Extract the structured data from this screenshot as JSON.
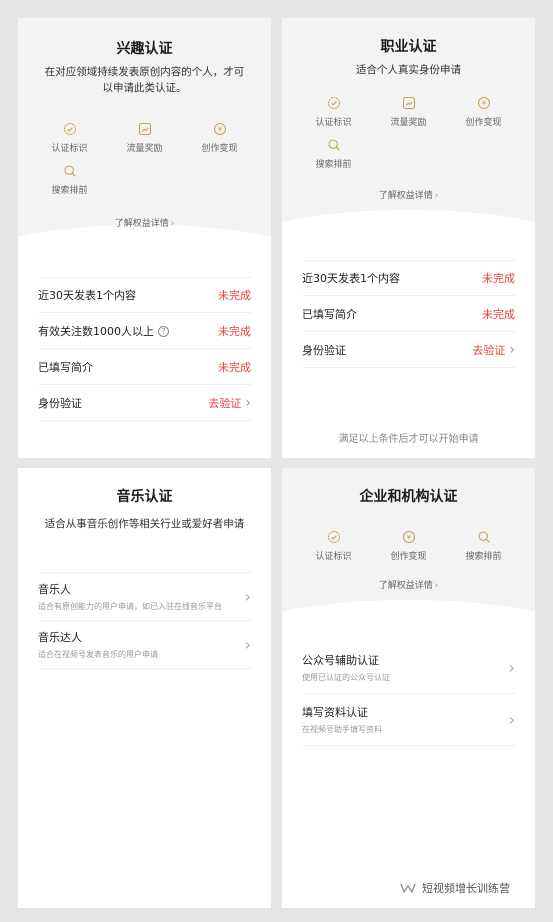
{
  "cards": {
    "interest": {
      "title": "兴趣认证",
      "subtitle_1": "在对应领域持续发表原创内容的个人，才可",
      "subtitle_2": "以申请此类认证。",
      "benefits": [
        "认证标识",
        "流量奖励",
        "创作变现",
        "搜索排前"
      ],
      "more": "了解权益详情",
      "requirements": [
        {
          "label": "近30天发表1个内容",
          "status": "未完成"
        },
        {
          "label": "有效关注数1000人以上",
          "status": "未完成"
        },
        {
          "label": "已填写简介",
          "status": "未完成"
        },
        {
          "label": "身份验证",
          "status": "去验证"
        }
      ]
    },
    "career": {
      "title": "职业认证",
      "subtitle": "适合个人真实身份申请",
      "benefits": [
        "认证标识",
        "流量奖励",
        "创作变现",
        "搜索排前"
      ],
      "more": "了解权益详情",
      "requirements": [
        {
          "label": "近30天发表1个内容",
          "status": "未完成"
        },
        {
          "label": "已填写简介",
          "status": "未完成"
        },
        {
          "label": "身份验证",
          "status": "去验证"
        }
      ],
      "footer": "满足以上条件后才可以开始申请"
    },
    "music": {
      "title": "音乐认证",
      "subtitle": "适合从事音乐创作等相关行业或爱好者申请",
      "options": [
        {
          "title": "音乐人",
          "desc": "适合有原创能力的用户申请，如已入驻在线音乐平台"
        },
        {
          "title": "音乐达人",
          "desc": "适合在视频号发表音乐的用户申请"
        }
      ]
    },
    "enterprise": {
      "title": "企业和机构认证",
      "benefits": [
        "认证标识",
        "创作变现",
        "搜索排前"
      ],
      "more": "了解权益详情",
      "options": [
        {
          "title": "公众号辅助认证",
          "desc": "使用已认证的公众号认证"
        },
        {
          "title": "填写资料认证",
          "desc": "在视频号助手填写资料"
        }
      ]
    }
  },
  "chevron": "›",
  "watermark": "短视频增长训练营",
  "colors": {
    "accent": "#e64340",
    "icon": "#c7a25a"
  }
}
